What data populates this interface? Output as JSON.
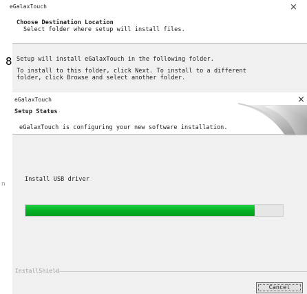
{
  "back_dialog": {
    "title": "eGalaxTouch",
    "heading": "Choose Destination Location",
    "subheading": "Select folder where setup will install files.",
    "step_number": "8",
    "line1": "Setup will install eGalaxTouch in the following folder.",
    "line2": "To install to this folder, click Next. To install to a different",
    "line3": "folder, click Browse and select another folder."
  },
  "front_dialog": {
    "title": "eGalaxTouch",
    "close_glyph": "×",
    "heading": "Setup Status",
    "status_text": "eGalaxTouch is configuring your new software installation.",
    "current_task": "Install USB driver",
    "progress_percent": 89,
    "footer_brand": "InstallShield",
    "cancel_label": "Cancel"
  },
  "left_edge_glyph": "n",
  "colors": {
    "progress_fill": "#06b025",
    "progress_track": "#e6e6e6",
    "dialog_body": "#f0f0f0",
    "header_bg": "#ffffff"
  }
}
